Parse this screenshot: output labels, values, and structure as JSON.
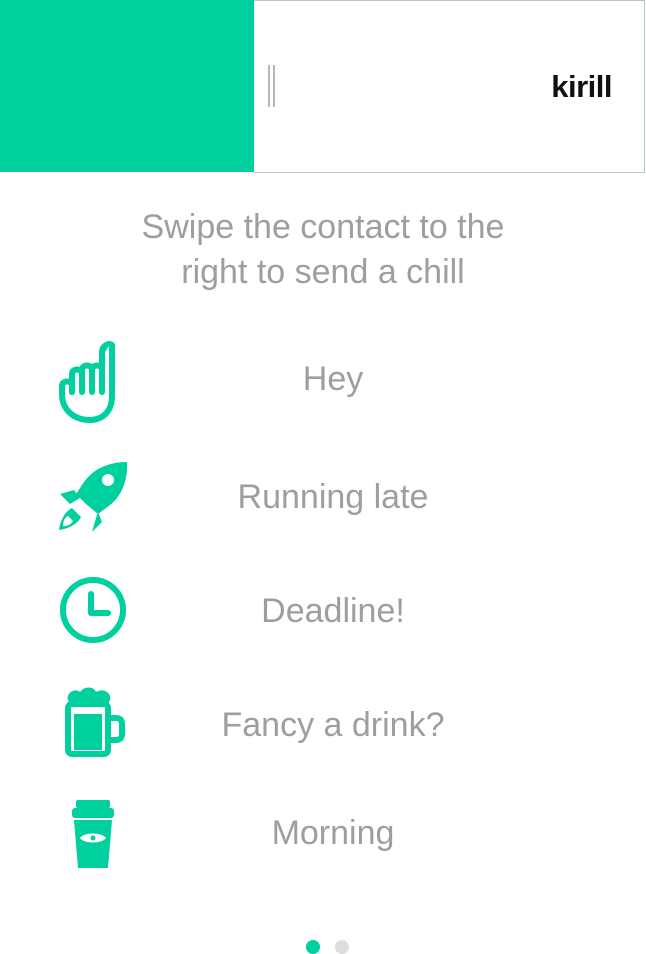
{
  "contact": {
    "name": "kirill",
    "swipe_color": "#00cf9e"
  },
  "instruction": {
    "line1": "Swipe the contact to the",
    "line2": "right to send a chill"
  },
  "chills": [
    {
      "label": "Hey",
      "icon": "shaka-hand-icon"
    },
    {
      "label": "Running late",
      "icon": "rocket-icon"
    },
    {
      "label": "Deadline!",
      "icon": "clock-icon"
    },
    {
      "label": "Fancy a drink?",
      "icon": "beer-mug-icon"
    },
    {
      "label": "Morning",
      "icon": "coffee-cup-icon"
    }
  ],
  "pager": {
    "current_page": 1,
    "total_pages": 2,
    "active_color": "#00cf9e",
    "inactive_color": "#dddddd"
  },
  "colors": {
    "accent": "#00cf9e",
    "text_muted": "#9e9e9e"
  }
}
